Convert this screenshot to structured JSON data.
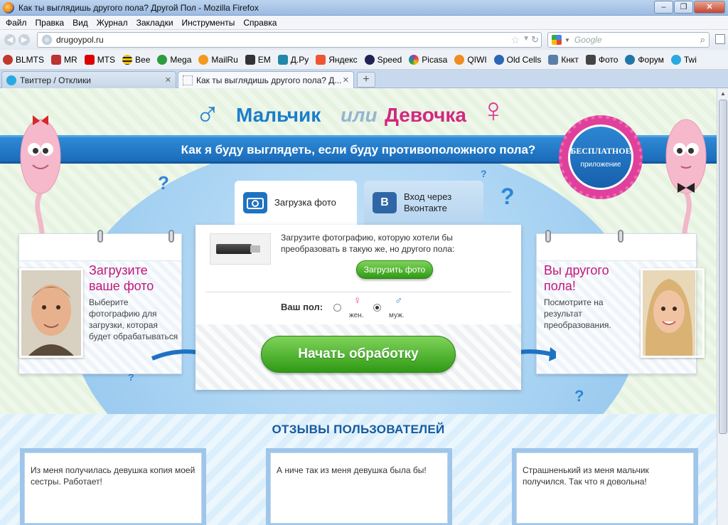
{
  "window": {
    "title": "Как ты выглядишь другого пола? Другой Пол - Mozilla Firefox",
    "controls": [
      "–",
      "❐",
      "✕"
    ]
  },
  "menu": [
    "Файл",
    "Правка",
    "Вид",
    "Журнал",
    "Закладки",
    "Инструменты",
    "Справка"
  ],
  "address": {
    "url": "drugoypol.ru"
  },
  "search": {
    "placeholder": "Google"
  },
  "bookmarks": [
    {
      "label": "BLMTS",
      "icon": "ladybug-icon",
      "color": "#c0392b"
    },
    {
      "label": "MR",
      "icon": "mr-icon",
      "color": "#b33"
    },
    {
      "label": "MTS",
      "icon": "mts-icon",
      "color": "#d00"
    },
    {
      "label": "Bee",
      "icon": "beeline-icon",
      "color": "#f4c20d"
    },
    {
      "label": "Mega",
      "icon": "megafon-icon",
      "color": "#2c9c3c"
    },
    {
      "label": "MailRu",
      "icon": "mailru-icon",
      "color": "#f29a1f"
    },
    {
      "label": "EM",
      "icon": "em-icon",
      "color": "#333"
    },
    {
      "label": "Д.Ру",
      "icon": "dru-icon",
      "color": "#28a"
    },
    {
      "label": "Яндекс",
      "icon": "yandex-icon",
      "color": "#e53"
    },
    {
      "label": "Speed",
      "icon": "speed-icon",
      "color": "#225"
    },
    {
      "label": "Picasa",
      "icon": "picasa-icon",
      "color": "#9c3bb5"
    },
    {
      "label": "QIWI",
      "icon": "qiwi-icon",
      "color": "#f08c1f"
    },
    {
      "label": "Old Cells",
      "icon": "cells-icon",
      "color": "#2b67b5"
    },
    {
      "label": "Кнкт",
      "icon": "vk-icon",
      "color": "#5a7fa6"
    },
    {
      "label": "Фото",
      "icon": "camera-icon",
      "color": "#444"
    },
    {
      "label": "Форум",
      "icon": "forum-icon",
      "color": "#27a"
    },
    {
      "label": "Twi",
      "icon": "twitter-icon",
      "color": "#2aa9e0"
    }
  ],
  "tabs": [
    {
      "label": "Твиттер / Отклики",
      "icon": "twitter-icon"
    },
    {
      "label": "Как ты выглядишь другого пола? Д...",
      "icon": "page-icon"
    }
  ],
  "new_tab": "+",
  "page": {
    "logo": {
      "male_symbol": "♂",
      "word1": "Мальчик",
      "word2": "или",
      "word3": "Девочка",
      "female_symbol": "♀"
    },
    "ribbon_text": "Как я буду выглядеть, если буду противоположного пола?",
    "badge": {
      "line1": "БЕСПЛАТНОЕ",
      "line2": "приложение"
    },
    "upload_tabs": [
      {
        "label": "Загрузка фото",
        "icon": "camera-icon"
      },
      {
        "label": "Вход через Вконтакте",
        "icon": "vk-icon"
      }
    ],
    "upload_text": "Загрузите фотографию, которую хотели бы преобразовать в такую же, но другого пола:",
    "upload_button": "Загрузить фото",
    "gender_label": "Ваш пол:",
    "gender_options": [
      {
        "symbol": "♀",
        "label": "жен.",
        "selected": false
      },
      {
        "symbol": "♂",
        "label": "муж.",
        "selected": true
      }
    ],
    "start_button": "Начать обработку",
    "left_card": {
      "title": "Загрузите ваше фото",
      "text": "Выберите фотографию для загрузки, которая будет обрабатываться"
    },
    "right_card": {
      "title": "Вы другого пола!",
      "text": "Посмотрите на результат преобразования."
    },
    "reviews_title": "ОТЗЫВЫ ПОЛЬЗОВАТЕЛЕЙ",
    "reviews": [
      "Из меня получилась девушка копия моей сестры. Работает!",
      "А ниче так из меня девушка была бы!",
      "Страшненький из меня мальчик получился. Так что я довольна!"
    ]
  },
  "colors": {
    "accent_blue": "#1b7ec9",
    "accent_pink": "#d2287f",
    "button_green": "#2f9a15",
    "ribbon_blue": "#1a6bb9"
  }
}
